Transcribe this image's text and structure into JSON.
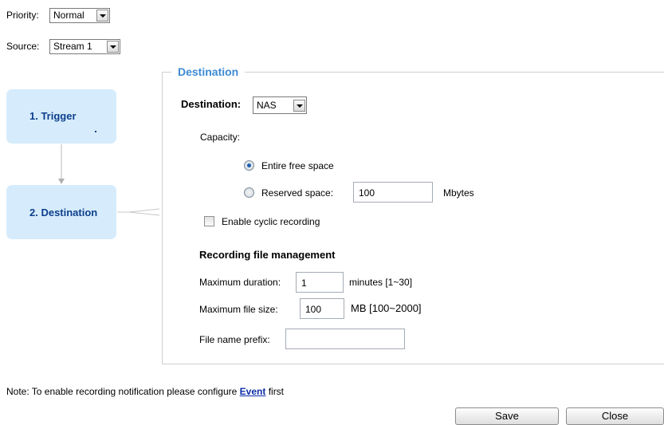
{
  "priority": {
    "label": "Priority:",
    "value": "Normal"
  },
  "source": {
    "label": "Source:",
    "value": "Stream 1"
  },
  "steps": [
    {
      "label": "1. Trigger"
    },
    {
      "label": "2. Destination"
    }
  ],
  "destination_section": {
    "legend": "Destination",
    "destination_label": "Destination:",
    "destination_value": "NAS",
    "capacity_label": "Capacity:",
    "entire_free_space_label": "Entire free space",
    "entire_free_space_checked": true,
    "reserved_space_label": "Reserved space:",
    "reserved_space_value": "100",
    "reserved_space_unit": "Mbytes",
    "cyclic_recording_label": "Enable cyclic recording",
    "cyclic_recording_checked": false,
    "file_management_heading": "Recording file management",
    "max_duration_label": "Maximum duration:",
    "max_duration_value": "1",
    "max_duration_hint": "minutes [1~30]",
    "max_file_size_label": "Maximum file size:",
    "max_file_size_value": "100",
    "max_file_size_hint": "MB [100~2000]",
    "file_name_prefix_label": "File name prefix:",
    "file_name_prefix_value": ""
  },
  "note": {
    "prefix": "Note: To enable recording notification please configure",
    "link": "Event",
    "suffix": "first"
  },
  "buttons": {
    "save": "Save",
    "close": "Close"
  },
  "colors": {
    "step_bg": "#d6ecfc",
    "step_text": "#0d3f8c",
    "legend": "#3c8bd4",
    "link": "#0d2ea8"
  }
}
